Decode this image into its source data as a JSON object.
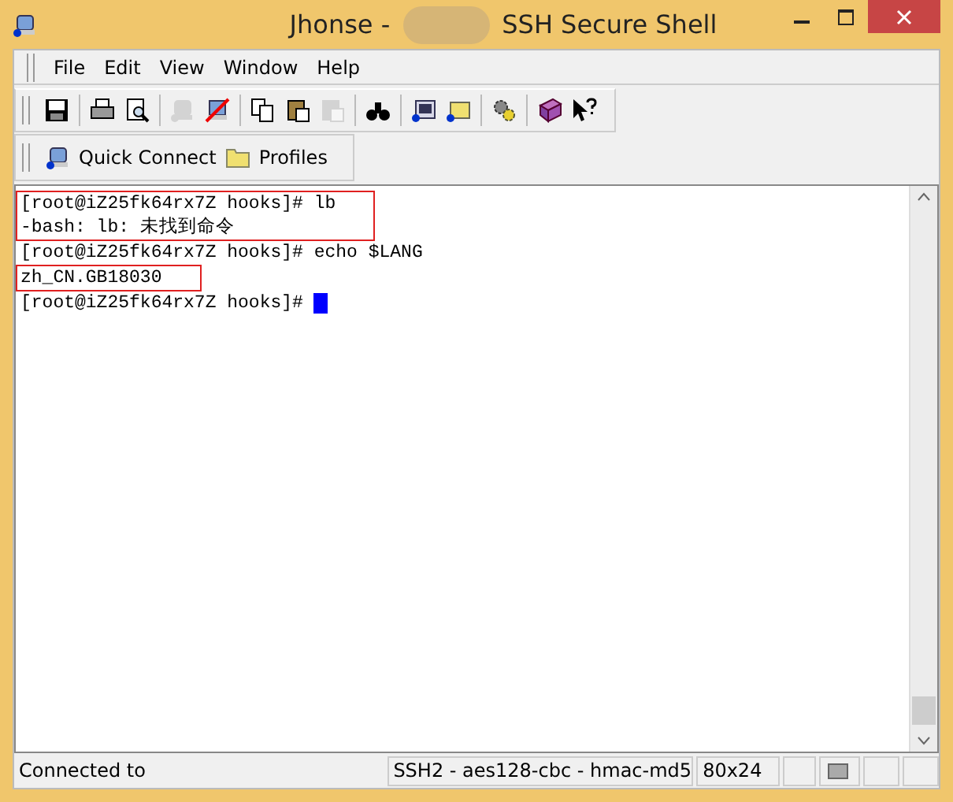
{
  "window": {
    "title_parts": [
      "Jhonse -",
      "SSH Secure Shell"
    ]
  },
  "menu": [
    "File",
    "Edit",
    "View",
    "Window",
    "Help"
  ],
  "toolbar": [
    {
      "kind": "save",
      "disabled": false
    },
    {
      "kind": "sep"
    },
    {
      "kind": "print",
      "disabled": false
    },
    {
      "kind": "preview",
      "disabled": false
    },
    {
      "kind": "sep"
    },
    {
      "kind": "connect",
      "disabled": true
    },
    {
      "kind": "disconnect",
      "disabled": false
    },
    {
      "kind": "sep"
    },
    {
      "kind": "copy",
      "disabled": false
    },
    {
      "kind": "paste",
      "disabled": false
    },
    {
      "kind": "paste",
      "disabled": true
    },
    {
      "kind": "sep"
    },
    {
      "kind": "find",
      "disabled": false
    },
    {
      "kind": "sep"
    },
    {
      "kind": "terminal",
      "disabled": false
    },
    {
      "kind": "transfer",
      "disabled": false
    },
    {
      "kind": "sep"
    },
    {
      "kind": "settings",
      "disabled": false
    },
    {
      "kind": "sep"
    },
    {
      "kind": "help",
      "disabled": false
    },
    {
      "kind": "whatsthis",
      "disabled": false
    }
  ],
  "quickbar": [
    {
      "kind": "connect",
      "label": "Quick Connect"
    },
    {
      "kind": "folder",
      "label": "Profiles"
    }
  ],
  "terminal": {
    "lines": [
      {
        "text": "[root@iZ25fk64rx7Z hooks]# lb",
        "highlighted": true
      },
      {
        "text": "-bash: lb: 未找到命令",
        "highlighted": true
      },
      {
        "text": "[root@iZ25fk64rx7Z hooks]# echo $LANG",
        "highlighted": false
      },
      {
        "text": "zh_CN.GB18030",
        "highlighted": true
      },
      {
        "text": "[root@iZ25fk64rx7Z hooks]# ",
        "highlighted": false,
        "cursor": true
      }
    ]
  },
  "status_bar": {
    "connection": "Connected to",
    "cipher": "SSH2 - aes128-cbc - hmac-md5",
    "size": "80x24"
  }
}
